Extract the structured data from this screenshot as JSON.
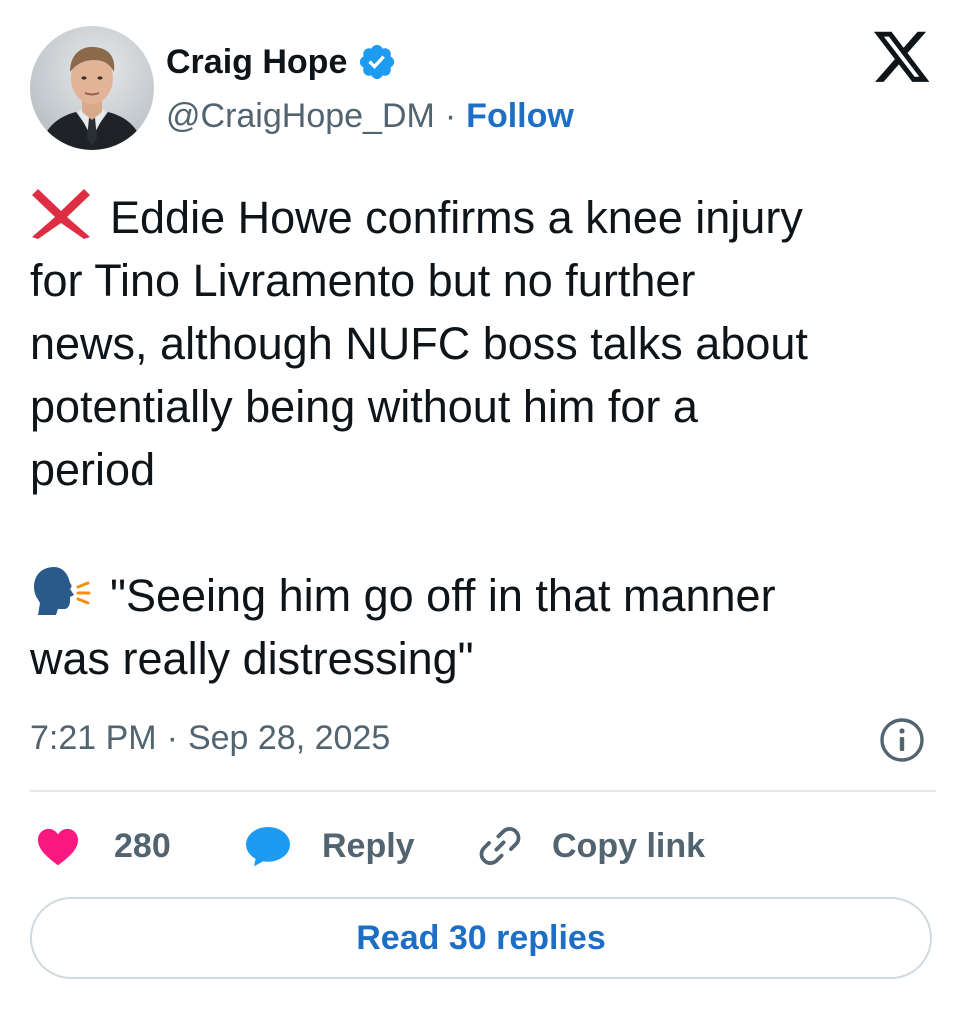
{
  "author": {
    "name": "Craig Hope",
    "handle": "@CraigHope_DM",
    "separator": "·",
    "follow_label": "Follow",
    "verified": true
  },
  "brand": {
    "logo_icon": "x-logo-icon"
  },
  "tweet": {
    "lines_block_1": [
      "Eddie Howe confirms a knee injury",
      "for Tino Livramento but no further",
      "news, although NUFC boss talks about",
      "potentially being without him for a",
      "period"
    ],
    "lead_emoji_1": "cross-mark-icon",
    "lead_emoji_2": "speaking-head-icon",
    "lines_block_2": [
      "\"Seeing him go off in that manner",
      "was really distressing\""
    ],
    "time": "7:21 PM",
    "separator": "·",
    "date": "Sep 28, 2025"
  },
  "actions": {
    "like_count": "280",
    "reply_label": "Reply",
    "copy_label": "Copy link",
    "read_replies_label": "Read 30 replies"
  },
  "colors": {
    "accent": "#1d6fc6",
    "verified": "#1d9bf0",
    "like": "#f91880",
    "secondary_text": "#536471",
    "cross": "#dd2e44"
  }
}
